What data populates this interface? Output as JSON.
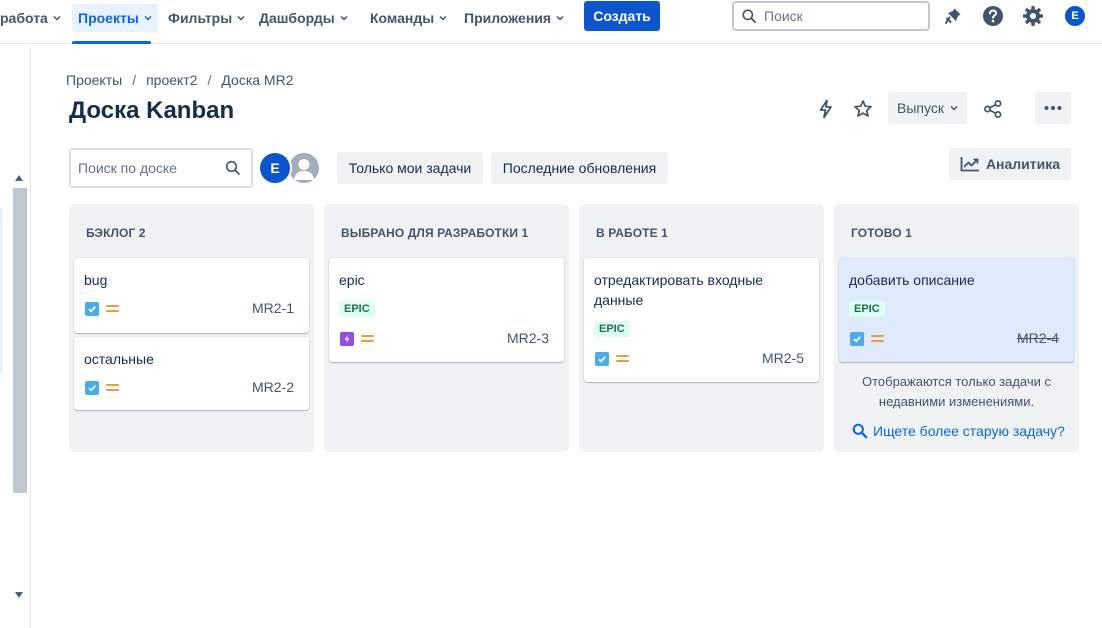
{
  "nav": {
    "items": [
      {
        "label": "работа",
        "active": false
      },
      {
        "label": "Проекты",
        "active": true
      },
      {
        "label": "Фильтры",
        "active": false
      },
      {
        "label": "Дашборды",
        "active": false
      },
      {
        "label": "Команды",
        "active": false
      },
      {
        "label": "Приложения",
        "active": false
      }
    ],
    "create_label": "Создать",
    "search_placeholder": "Поиск",
    "avatar_initial": "E"
  },
  "breadcrumb": [
    "Проекты",
    "проект2",
    "Доска MR2"
  ],
  "page_title": "Доска Kanban",
  "header": {
    "release_label": "Выпуск"
  },
  "filters": {
    "board_search_placeholder": "Поиск по доске",
    "avatar_initial": "E",
    "chip_my_tasks": "Только мои задачи",
    "chip_recent": "Последние обновления",
    "analytics_label": "Аналитика"
  },
  "columns": [
    {
      "title": "БЭКЛОГ 2",
      "cards": [
        {
          "title": "bug",
          "key": "MR2-1",
          "type": "task"
        },
        {
          "title": "остальные",
          "key": "MR2-2",
          "type": "task"
        }
      ]
    },
    {
      "title": "ВЫБРАНО ДЛЯ РАЗРАБОТКИ 1",
      "cards": [
        {
          "title": "epic",
          "epic": "EPIC",
          "key": "MR2-3",
          "type": "epic"
        }
      ]
    },
    {
      "title": "В РАБОТЕ 1",
      "cards": [
        {
          "title": "отредактировать входные данные",
          "epic": "EPIC",
          "key": "MR2-5",
          "type": "task"
        }
      ]
    },
    {
      "title": "ГОТОВО 1",
      "cards": [
        {
          "title": "добавить описание",
          "epic": "EPIC",
          "key": "MR2-4",
          "type": "task",
          "done": true
        }
      ],
      "hint": "Отображаются только задачи с недавними изменениями.",
      "older_link": "Ищете более старую задачу?"
    }
  ],
  "colors": {
    "primary": "#0c55cc",
    "link": "#0c66e4",
    "epic_bg": "#dcfff1",
    "epic_text": "#216e4e",
    "priority": "#e2a03f",
    "task_icon": "#4bade8",
    "epic_icon": "#904ee2"
  }
}
